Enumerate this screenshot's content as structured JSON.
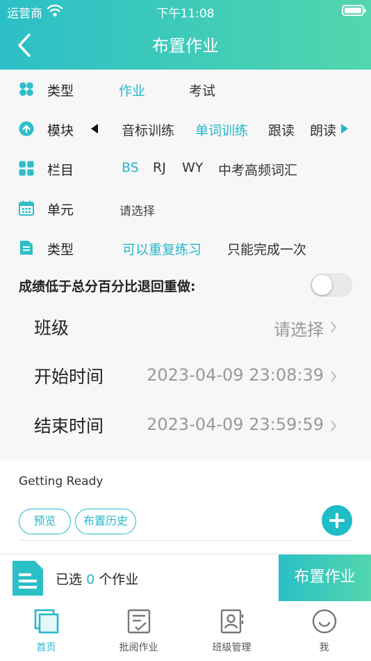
{
  "status_bar": {
    "carrier": "运营商",
    "time": "下午11:08"
  },
  "header": {
    "title": "布置作业"
  },
  "form": {
    "type": {
      "label": "类型",
      "options": [
        "作业",
        "考试"
      ],
      "selected": "作业"
    },
    "module": {
      "label": "模块",
      "options": [
        "音标训练",
        "单词训练",
        "跟读",
        "朗读"
      ],
      "selected": "单词训练"
    },
    "column": {
      "label": "栏目",
      "options": [
        "BS",
        "RJ",
        "WY",
        "中考高频词汇"
      ],
      "selected": "BS"
    },
    "unit": {
      "label": "单元",
      "placeholder": "请选择"
    },
    "practice_type": {
      "label": "类型",
      "options": [
        "可以重复练习",
        "只能完成一次"
      ],
      "selected": "可以重复练习"
    },
    "retry": {
      "label": "成绩低于总分百分比退回重做:",
      "enabled": false
    },
    "class": {
      "label": "班级",
      "value": "请选择"
    },
    "start_time": {
      "label": "开始时间",
      "value": "2023-04-09 23:08:39"
    },
    "end_time": {
      "label": "结束时间",
      "value": "2023-04-09 23:59:59"
    }
  },
  "homework_panel": {
    "title": "Getting Ready",
    "preview_label": "预览",
    "history_label": "布置历史"
  },
  "summary": {
    "prefix": "已选",
    "count": "0",
    "suffix": "个作业",
    "assign_label": "布置作业"
  },
  "tabbar": {
    "tabs": [
      {
        "label": "首页",
        "icon": "home-icon",
        "active": true
      },
      {
        "label": "批阅作业",
        "icon": "review-icon",
        "active": false
      },
      {
        "label": "班级管理",
        "icon": "class-icon",
        "active": false
      },
      {
        "label": "我",
        "icon": "profile-icon",
        "active": false
      }
    ]
  },
  "colors": {
    "accent": "#25b8cc",
    "header_start": "#2bbfc7",
    "header_end": "#52d6ad"
  }
}
